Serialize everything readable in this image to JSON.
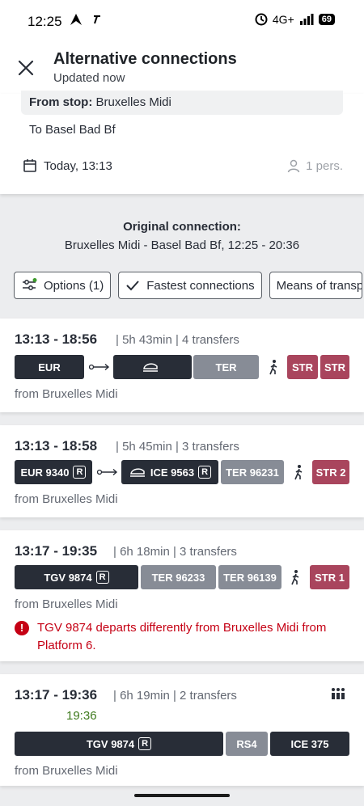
{
  "status_bar": {
    "time": "12:25",
    "network": "4G+",
    "battery": "69"
  },
  "header": {
    "title": "Alternative connections",
    "subtitle": "Updated now"
  },
  "search": {
    "from_label": "From stop:",
    "from_value": "Bruxelles Midi",
    "to": "To Basel Bad Bf",
    "date": "Today, 13:13",
    "persons": "1 pers."
  },
  "original": {
    "title": "Original connection:",
    "route": "Bruxelles Midi - Basel Bad Bf, 12:25 - 20:36"
  },
  "filters": {
    "options": "Options (1)",
    "fastest": "Fastest connections",
    "means": "Means of transp"
  },
  "connections": [
    {
      "time": "13:13 - 18:56",
      "duration": "5h 43min",
      "transfers": "4 transfers",
      "from": "from Bruxelles Midi",
      "segments": [
        "EUR",
        "",
        "TER",
        "STR",
        "STR"
      ]
    },
    {
      "time": "13:13 - 18:58",
      "duration": "5h 45min",
      "transfers": "3 transfers",
      "from": "from Bruxelles Midi",
      "segments": [
        "EUR 9340",
        "ICE 9563",
        "TER 96231",
        "STR 2"
      ],
      "r_mark": "R"
    },
    {
      "time": "13:17 - 19:35",
      "duration": "6h 18min",
      "transfers": "3 transfers",
      "from": "from Bruxelles Midi",
      "segments": [
        "TGV 9874",
        "TER 96233",
        "TER 96139",
        "STR 1"
      ],
      "warning": "TGV 9874 departs differently from Bruxelles Midi from Platform 6."
    },
    {
      "time": "13:17 - 19:36",
      "duration": "6h 19min",
      "transfers": "2 transfers",
      "delay": "19:36",
      "from": "from Bruxelles Midi",
      "segments": [
        "TGV 9874",
        "RS4",
        "ICE 375"
      ]
    }
  ],
  "colors": {
    "dark_segment": "#282d37",
    "gray_segment": "#878c96",
    "tram_segment": "#a9455d",
    "warning": "#c50014",
    "delay_green": "#3e7a1d"
  }
}
